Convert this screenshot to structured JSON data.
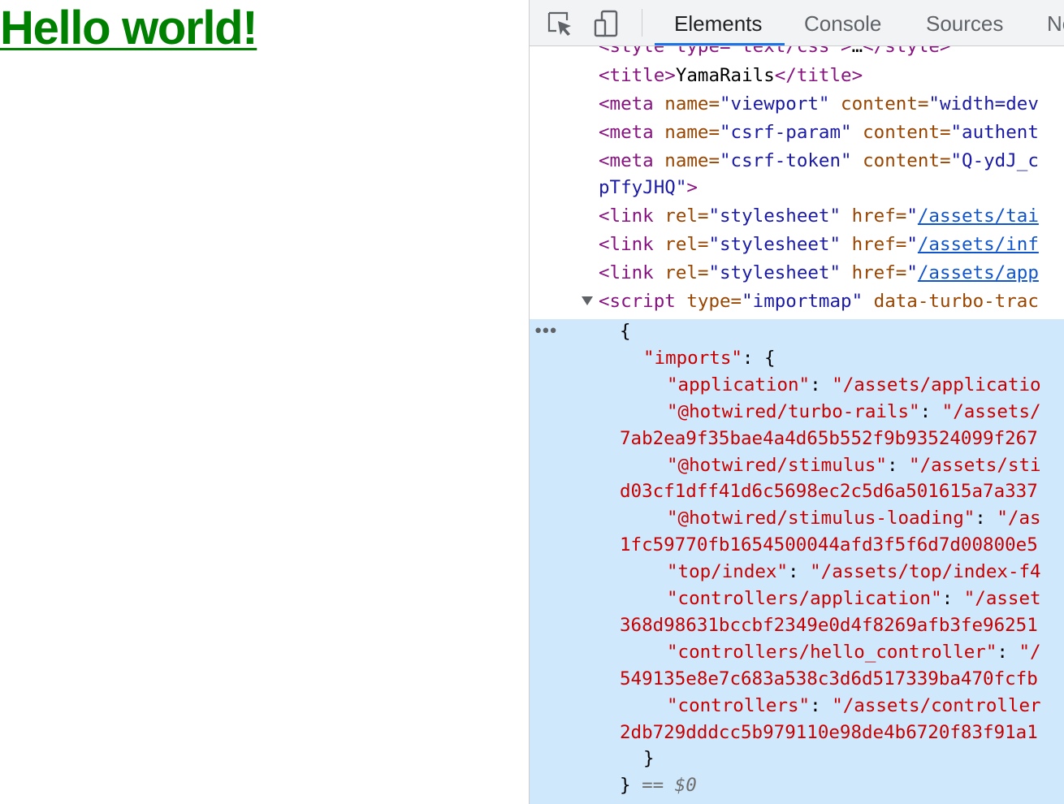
{
  "page": {
    "heading": "Hello world!"
  },
  "devtools": {
    "tabs": [
      "Elements",
      "Console",
      "Sources",
      "Ne"
    ],
    "inspect_icon": "element-picker-icon",
    "device_icon": "device-toolbar-icon",
    "tree": {
      "style_line": {
        "open": "<style type=\"text/css\">",
        "ellipsis": "…",
        "close": "</style>"
      },
      "title": {
        "open": "<title>",
        "text": "YamaRails",
        "close": "</title>"
      },
      "meta_viewport": {
        "tag": "<meta",
        "n": "name=",
        "nv": "\"viewport\"",
        "c": "content=",
        "cv": "\"width=dev"
      },
      "meta_param": {
        "tag": "<meta",
        "n": "name=",
        "nv": "\"csrf-param\"",
        "c": "content=",
        "cv": "\"authent"
      },
      "meta_token": {
        "tag": "<meta",
        "n": "name=",
        "nv": "\"csrf-token\"",
        "c": "content=",
        "cv": "\"Q-ydJ_c"
      },
      "meta_token_cont": {
        "v": "pTfyJHQ\"",
        "close": ">"
      },
      "links": [
        {
          "tag": "<link",
          "r": "rel=",
          "rv": "\"stylesheet\"",
          "h": "href=",
          "q": "\"",
          "hv": "/assets/tai"
        },
        {
          "tag": "<link",
          "r": "rel=",
          "rv": "\"stylesheet\"",
          "h": "href=",
          "q": "\"",
          "hv": "/assets/inf"
        },
        {
          "tag": "<link",
          "r": "rel=",
          "rv": "\"stylesheet\"",
          "h": "href=",
          "q": "\"",
          "hv": "/assets/app"
        }
      ],
      "script": {
        "tag": "<script",
        "t": "type=",
        "tv": "\"importmap\"",
        "d": "data-turbo-trac"
      },
      "json_lines": [
        {
          "indent": 0,
          "text": "{"
        },
        {
          "indent": 1,
          "key": "\"imports\"",
          "rest": ": {"
        },
        {
          "indent": 2,
          "key": "\"application\"",
          "val": "\"/assets/applicatio"
        },
        {
          "indent": 2,
          "key": "\"@hotwired/turbo-rails\"",
          "val": "\"/assets/"
        },
        {
          "indent": 0,
          "val": "7ab2ea9f35bae4a4d65b552f9b93524099f267"
        },
        {
          "indent": 2,
          "key": "\"@hotwired/stimulus\"",
          "val": "\"/assets/sti"
        },
        {
          "indent": 0,
          "val": "d03cf1dff41d6c5698ec2c5d6a501615a7a337"
        },
        {
          "indent": 2,
          "key": "\"@hotwired/stimulus-loading\"",
          "val": "\"/as"
        },
        {
          "indent": 0,
          "val": "1fc59770fb1654500044afd3f5f6d7d00800e5"
        },
        {
          "indent": 2,
          "key": "\"top/index\"",
          "val": "\"/assets/top/index-f4"
        },
        {
          "indent": 2,
          "key": "\"controllers/application\"",
          "val": "\"/asset"
        },
        {
          "indent": 0,
          "val": "368d98631bccbf2349e0d4f8269afb3fe96251"
        },
        {
          "indent": 2,
          "key": "\"controllers/hello_controller\"",
          "val": "\"/"
        },
        {
          "indent": 0,
          "val": "549135e8e7c683a538c3d6d517339ba470fcfb"
        },
        {
          "indent": 2,
          "key": "\"controllers\"",
          "val": "\"/assets/controller"
        },
        {
          "indent": 0,
          "val": "2db729dddcc5b979110e98de4b6720f83f91a1"
        },
        {
          "indent": 1,
          "text": "}"
        },
        {
          "indent": 0,
          "text": "}",
          "marker": "== $0"
        }
      ]
    }
  }
}
